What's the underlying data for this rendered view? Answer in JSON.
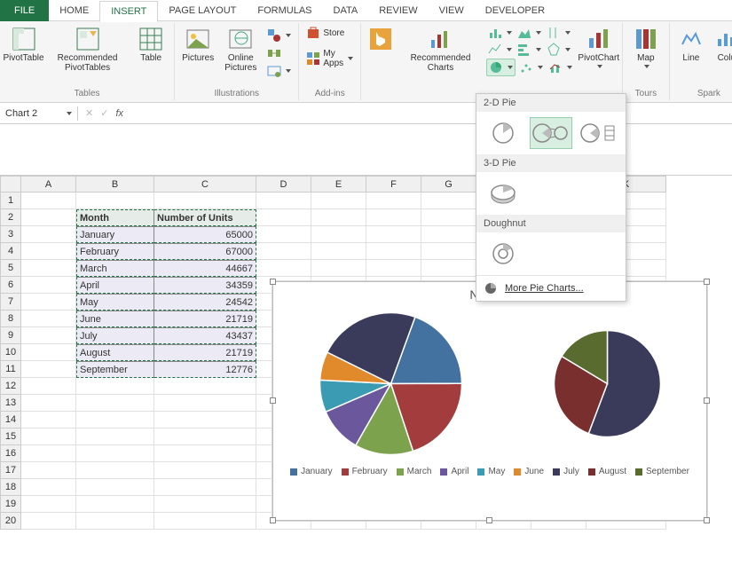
{
  "tabs": {
    "file": "FILE",
    "home": "HOME",
    "insert": "INSERT",
    "pagelayout": "PAGE LAYOUT",
    "formulas": "FORMULAS",
    "data": "DATA",
    "review": "REVIEW",
    "view": "VIEW",
    "developer": "DEVELOPER"
  },
  "ribbon": {
    "tables": {
      "pivottable": "PivotTable",
      "recommended_pt": "Recommended PivotTables",
      "table": "Table",
      "group": "Tables"
    },
    "illustrations": {
      "pictures": "Pictures",
      "online_pictures": "Online Pictures",
      "group": "Illustrations"
    },
    "addins": {
      "store": "Store",
      "myapps": "My Apps",
      "group": "Add-ins"
    },
    "charts": {
      "recommended": "Recommended Charts",
      "pivotchart": "PivotChart",
      "group": "Charts"
    },
    "tours": {
      "map": "Map",
      "group": "Tours"
    },
    "sparklines": {
      "line": "Line",
      "column": "Colu",
      "group": "Spark"
    }
  },
  "pie_panel": {
    "sect_2d": "2-D Pie",
    "sect_3d": "3-D Pie",
    "sect_doughnut": "Doughnut",
    "more": "More Pie Charts..."
  },
  "namebox": "Chart 2",
  "columns": [
    "A",
    "B",
    "C",
    "D",
    "E",
    "F",
    "G",
    "K"
  ],
  "row_nums": [
    1,
    2,
    3,
    4,
    5,
    6,
    7,
    8,
    9,
    10,
    11,
    12,
    13,
    14,
    15,
    16,
    17,
    18,
    19,
    20
  ],
  "table": {
    "headers": {
      "b": "Month",
      "c": "Number of Units"
    },
    "rows": [
      {
        "b": "January",
        "c": "65000"
      },
      {
        "b": "February",
        "c": "67000"
      },
      {
        "b": "March",
        "c": "44667"
      },
      {
        "b": "April",
        "c": "34359"
      },
      {
        "b": "May",
        "c": "24542"
      },
      {
        "b": "June",
        "c": "21719"
      },
      {
        "b": "July",
        "c": "43437"
      },
      {
        "b": "August",
        "c": "21719"
      },
      {
        "b": "September",
        "c": "12776"
      }
    ]
  },
  "chart": {
    "title": "Numbe"
  },
  "chart_data": {
    "type": "pie",
    "title": "Number of Units",
    "categories": [
      "January",
      "February",
      "March",
      "April",
      "May",
      "June",
      "July",
      "August",
      "September"
    ],
    "values": [
      65000,
      67000,
      44667,
      34359,
      24542,
      21719,
      43437,
      21719,
      12776
    ],
    "colors": [
      "#4472a0",
      "#a33d3d",
      "#7da24e",
      "#6b579b",
      "#3b9bb3",
      "#e08a2c",
      "#3a3a5a",
      "#7a2f2f",
      "#5a6b2f"
    ],
    "subtype": "pie-of-pie",
    "secondary_from_end": 3
  }
}
